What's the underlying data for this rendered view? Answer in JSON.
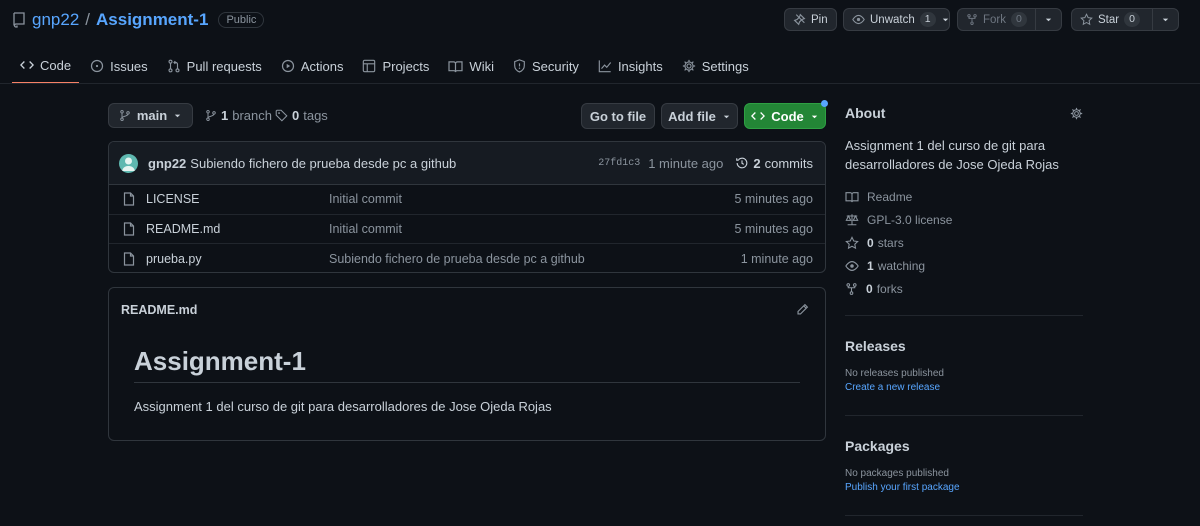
{
  "repo": {
    "owner": "gnp22",
    "separator": "/",
    "name": "Assignment-1",
    "visibility": "Public"
  },
  "header_buttons": {
    "pin": "Pin",
    "unwatch": "Unwatch",
    "unwatch_count": "1",
    "fork": "Fork",
    "fork_count": "0",
    "star": "Star",
    "star_count": "0"
  },
  "tabs": [
    {
      "label": "Code",
      "icon": "code-icon",
      "active": true
    },
    {
      "label": "Issues",
      "icon": "issues-icon"
    },
    {
      "label": "Pull requests",
      "icon": "pull-request-icon"
    },
    {
      "label": "Actions",
      "icon": "play-icon"
    },
    {
      "label": "Projects",
      "icon": "table-icon"
    },
    {
      "label": "Wiki",
      "icon": "book-icon"
    },
    {
      "label": "Security",
      "icon": "shield-icon"
    },
    {
      "label": "Insights",
      "icon": "graph-icon"
    },
    {
      "label": "Settings",
      "icon": "gear-icon"
    }
  ],
  "branch_bar": {
    "branch": "main",
    "branch_count": "1",
    "branch_label": "branch",
    "tag_count": "0",
    "tag_label": "tags",
    "go_to_file": "Go to file",
    "add_file": "Add file",
    "code": "Code"
  },
  "latest_commit": {
    "author": "gnp22",
    "message": "Subiendo fichero de prueba desde pc a github",
    "sha": "27fd1c3",
    "age": "1 minute ago",
    "commit_count": "2",
    "commit_label": "commits"
  },
  "files": [
    {
      "name": "LICENSE",
      "message": "Initial commit",
      "age": "5 minutes ago"
    },
    {
      "name": "README.md",
      "message": "Initial commit",
      "age": "5 minutes ago"
    },
    {
      "name": "prueba.py",
      "message": "Subiendo fichero de prueba desde pc a github",
      "age": "1 minute ago"
    }
  ],
  "readme": {
    "filename": "README.md",
    "heading": "Assignment-1",
    "body": "Assignment 1 del curso de git para desarrolladores de Jose Ojeda Rojas"
  },
  "about": {
    "title": "About",
    "description": "Assignment 1 del curso de git para desarrolladores de Jose Ojeda Rojas",
    "readme": "Readme",
    "license": "GPL-3.0 license",
    "stars_count": "0",
    "stars_label": "stars",
    "watching_count": "1",
    "watching_label": "watching",
    "forks_count": "0",
    "forks_label": "forks"
  },
  "releases": {
    "title": "Releases",
    "empty": "No releases published",
    "link": "Create a new release"
  },
  "packages": {
    "title": "Packages",
    "empty": "No packages published",
    "link": "Publish your first package"
  },
  "colors": {
    "accent_link": "#58a6ff",
    "green_button": "#238636",
    "tab_underline": "#f78166",
    "background": "#0d1117"
  }
}
